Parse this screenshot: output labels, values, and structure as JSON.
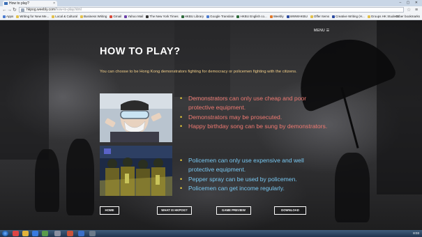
{
  "browser": {
    "tab_title": "How to play?",
    "url_host": "hkpog.weebly.com",
    "url_path": "/how-to-play.html",
    "bookmarks": [
      {
        "label": "Apps",
        "color": "#4a7bd0"
      },
      {
        "label": "Writing for New Me...",
        "color": "#e2c04a"
      },
      {
        "label": "Local & Cultural",
        "color": "#e2c04a"
      },
      {
        "label": "Business Writing",
        "color": "#e2c04a"
      },
      {
        "label": "Gmail",
        "color": "#d94a3a"
      },
      {
        "label": "Yahoo Mail",
        "color": "#6a3fa8"
      },
      {
        "label": "The New York Times",
        "color": "#333333"
      },
      {
        "label": "HKBU Library",
        "color": "#2d6a3a"
      },
      {
        "label": "Google Translate",
        "color": "#4a7bd0"
      },
      {
        "label": "HKBU English co...",
        "color": "#2d6a3a"
      },
      {
        "label": "Weebly",
        "color": "#e0782a"
      },
      {
        "label": "WWWHKBU",
        "color": "#2a4aa0"
      },
      {
        "label": "Offer Items",
        "color": "#e2c04a"
      },
      {
        "label": "Creative Writing (H...",
        "color": "#2a4aa0"
      },
      {
        "label": "Groups HK Student...",
        "color": "#e2c04a"
      }
    ],
    "bookmarks_right": "Other bookmarks"
  },
  "site": {
    "menu_label": "MENU ☰",
    "title": "HOW TO PLAY?",
    "intro": "You can choose to be Hong Kong demonstrators fighting for democracy or policemen fighting with the citizens.",
    "demonstrator_points": [
      "Demonstrators can only use cheap and poor protective equipment.",
      "Demonstrators may be prosecuted.",
      "Happy birthday song can be sung by demonstrators."
    ],
    "police_points": [
      "Policemen can only use expensive and well protective equipment.",
      "Pepper spray can be used by policemen.",
      "Policemen can get income regularly."
    ],
    "nav_buttons": [
      "HOME",
      "WHAT IS HKPOG?",
      "GAME PREVIEW",
      "DOWNLOAD"
    ]
  },
  "taskbar": {
    "clock": "8:03"
  },
  "colors": {
    "intro_text": "#f4d08a",
    "demonstrator_text": "#f07a72",
    "police_text": "#78c8f2",
    "bullet": "#f0d23c"
  }
}
